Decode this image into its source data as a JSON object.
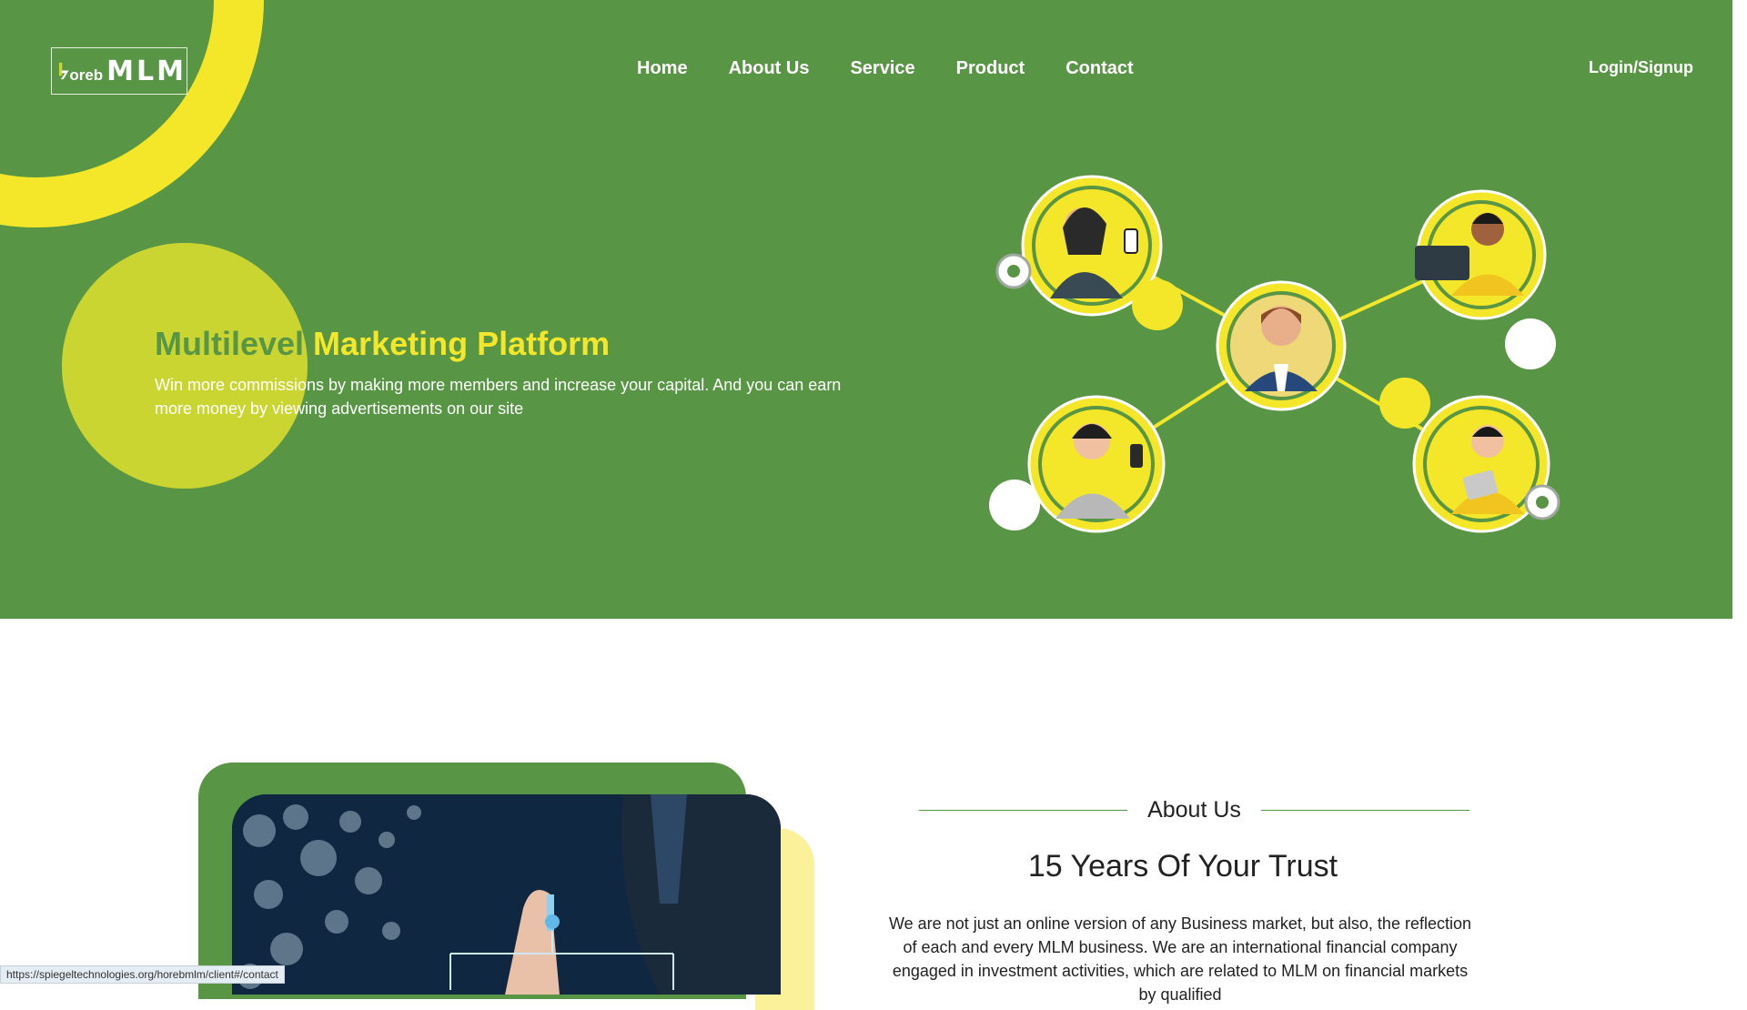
{
  "brand": {
    "logo_small": "oreb",
    "logo_big": "MLM",
    "colors": {
      "green": "#589645",
      "yellow": "#f4e72a",
      "lime": "#cbd532"
    }
  },
  "nav": {
    "items": [
      {
        "label": "Home"
      },
      {
        "label": "About Us"
      },
      {
        "label": "Service"
      },
      {
        "label": "Product"
      },
      {
        "label": "Contact"
      }
    ],
    "login": "Login/Signup"
  },
  "hero": {
    "title_part1": "Multilevel",
    "title_part2": " Marketing Platform",
    "subtitle": "Win more commissions by making more members and increase your capital. And you can earn more money by viewing advertisements on our site"
  },
  "about": {
    "label": "About Us",
    "heading": "15 Years Of Your Trust",
    "body": "We are not just an online version of any Business market, but also, the reflection of each and every MLM business.  We are an international financial company engaged in investment activities, which are related to MLM on financial markets by qualified"
  },
  "status_bar": {
    "url": "https://spiegeltechnologies.org/horebmlm/client#/contact"
  }
}
